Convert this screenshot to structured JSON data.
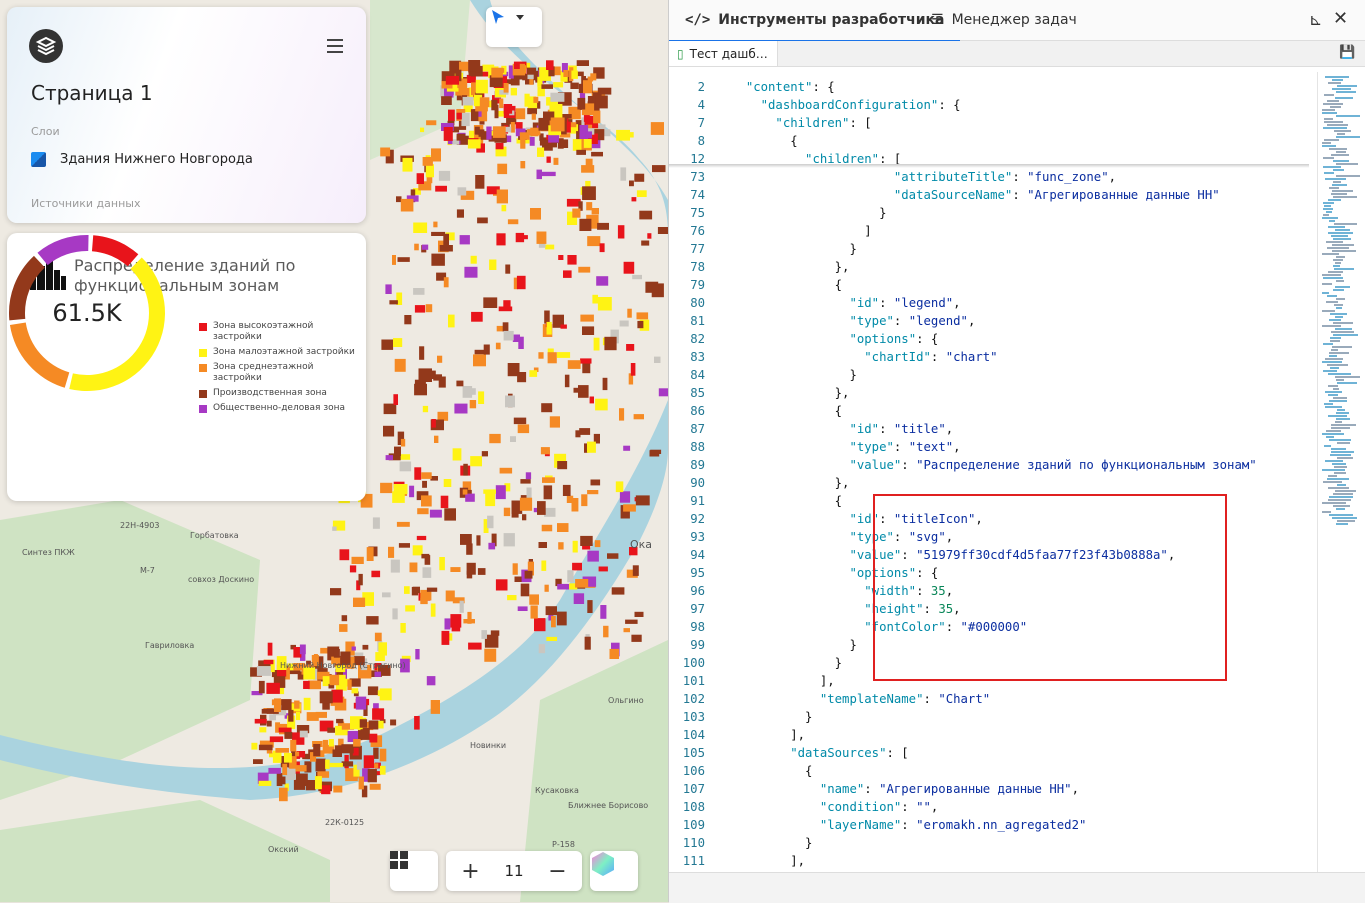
{
  "map": {
    "card": {
      "page_title": "Страница 1",
      "layers_label": "Слои",
      "layer_name": "Здания Нижнего Новгорода",
      "sources_label": "Источники данных"
    },
    "chart_card": {
      "title": "Распределение зданий по функциональным зонам",
      "center_value": "61.5K",
      "legend": [
        {
          "label": "Зона высокоэтажной застройки",
          "color": "#e8141b"
        },
        {
          "label": "Зона малоэтажной застройки",
          "color": "#fff314"
        },
        {
          "label": "Зона среднеэтажной застройки",
          "color": "#f58a24"
        },
        {
          "label": "Производственная зона",
          "color": "#93391b"
        },
        {
          "label": "Общественно-деловая зона",
          "color": "#a739c4"
        }
      ]
    },
    "zoom_level": "11",
    "labels": {
      "road1": "22Н-4903",
      "place1": "Горбатовка",
      "place2": "Синтез ПКЖ",
      "road2": "М-7",
      "place3": "совхоз Доскино",
      "place4": "Гавриловка",
      "place5": "Нижний Новгород (Стригино)",
      "place6": "Новинки",
      "place7": "Кусаковка",
      "place8": "Ближнее Борисово",
      "road3": "22К-0125",
      "road4": "Р-158",
      "place9": "Окский",
      "place10": "Ольгино",
      "river": "Ока"
    }
  },
  "chart_data": {
    "type": "pie",
    "categories": [
      "Зона высокоэтажной застройки",
      "Зона малоэтажной застройки",
      "Зона среднеэтажной застройки",
      "Производственная зона",
      "Общественно-деловая зона"
    ],
    "values": [
      10,
      38,
      17,
      14,
      11
    ],
    "title": "Распределение зданий по функциональным зонам",
    "total_label": "61.5K"
  },
  "devtools": {
    "tab_dev": "Инструменты разработчика",
    "tab_tasks": "Менеджер задач",
    "file_tab": "Тест дашб…",
    "lines": [
      [
        "2",
        "  \"content\": {"
      ],
      [
        "4",
        "    \"dashboardConfiguration\": {"
      ],
      [
        "7",
        "      \"children\": ["
      ],
      [
        "8",
        "        {"
      ],
      [
        "12",
        "          \"children\": ["
      ],
      [
        "73",
        "                      \"attributeTitle\": \"func_zone\","
      ],
      [
        "74",
        "                      \"dataSourceName\": \"Агрегированные данные НН\""
      ],
      [
        "75",
        "                    }"
      ],
      [
        "76",
        "                  ]"
      ],
      [
        "77",
        "                }"
      ],
      [
        "78",
        "              },"
      ],
      [
        "79",
        "              {"
      ],
      [
        "80",
        "                \"id\": \"legend\","
      ],
      [
        "81",
        "                \"type\": \"legend\","
      ],
      [
        "82",
        "                \"options\": {"
      ],
      [
        "83",
        "                  \"chartId\": \"chart\""
      ],
      [
        "84",
        "                }"
      ],
      [
        "85",
        "              },"
      ],
      [
        "86",
        "              {"
      ],
      [
        "87",
        "                \"id\": \"title\","
      ],
      [
        "88",
        "                \"type\": \"text\","
      ],
      [
        "89",
        "                \"value\": \"Распределение зданий по функциональным зонам\""
      ],
      [
        "90",
        "              },"
      ],
      [
        "91",
        "              {"
      ],
      [
        "92",
        "                \"id\": \"titleIcon\","
      ],
      [
        "93",
        "                \"type\": \"svg\","
      ],
      [
        "94",
        "                \"value\": \"51979ff30cdf4d5faa77f23f43b0888a\","
      ],
      [
        "95",
        "                \"options\": {"
      ],
      [
        "96",
        "                  \"width\": 35,"
      ],
      [
        "97",
        "                  \"height\": 35,"
      ],
      [
        "98",
        "                  \"fontColor\": \"#000000\""
      ],
      [
        "99",
        "                }"
      ],
      [
        "100",
        "              }"
      ],
      [
        "101",
        "            ],"
      ],
      [
        "102",
        "            \"templateName\": \"Chart\""
      ],
      [
        "103",
        "          }"
      ],
      [
        "104",
        "        ],"
      ],
      [
        "105",
        "        \"dataSources\": ["
      ],
      [
        "106",
        "          {"
      ],
      [
        "107",
        "            \"name\": \"Агрегированные данные НН\","
      ],
      [
        "108",
        "            \"condition\": \"\","
      ],
      [
        "109",
        "            \"layerName\": \"eromakh.nn_agregated2\""
      ],
      [
        "110",
        "          }"
      ],
      [
        "111",
        "        ],"
      ]
    ]
  }
}
